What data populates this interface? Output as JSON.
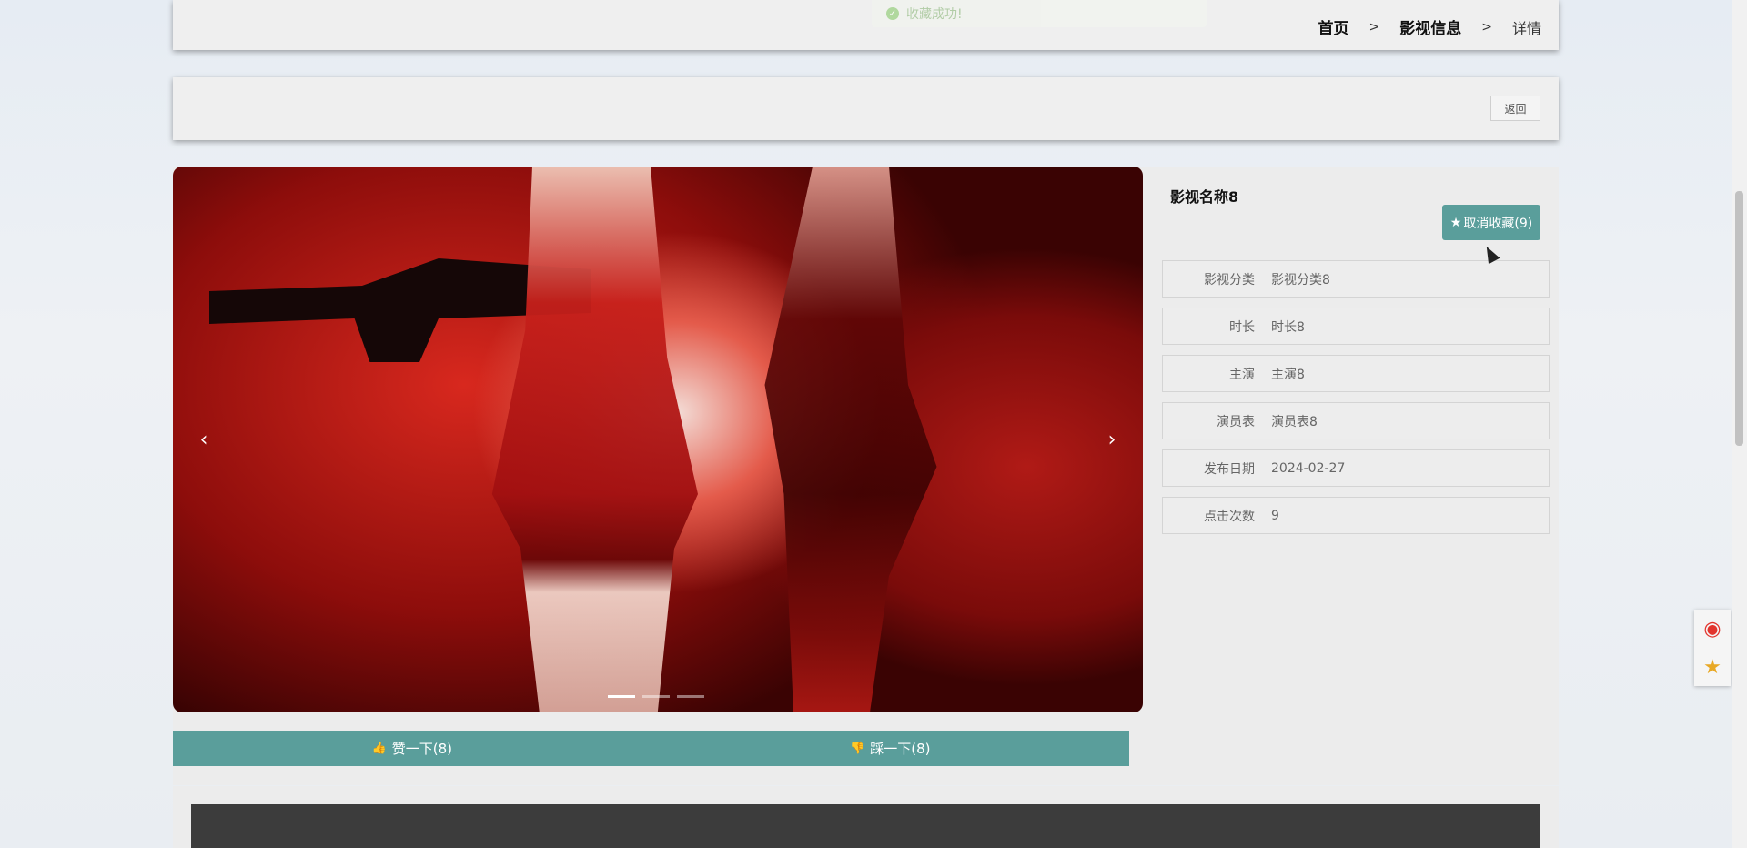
{
  "toast": {
    "message": "收藏成功!"
  },
  "breadcrumb": {
    "home": "首页",
    "section": "影视信息",
    "current": "详情",
    "separator": ">"
  },
  "back_button": "返回",
  "carousel": {
    "prev": "‹",
    "next": "›",
    "slide_count": 3,
    "active_slide": 1
  },
  "votes": {
    "like_label": "赞一下(8)",
    "dislike_label": "踩一下(8)"
  },
  "movie": {
    "title": "影视名称8",
    "favorite_button": "取消收藏(9)",
    "fields": [
      {
        "label": "影视分类",
        "value": "影视分类8"
      },
      {
        "label": "时长",
        "value": "时长8"
      },
      {
        "label": "主演",
        "value": "主演8"
      },
      {
        "label": "演员表",
        "value": "演员表8"
      },
      {
        "label": "发布日期",
        "value": "2024-02-27"
      },
      {
        "label": "点击次数",
        "value": "9"
      }
    ]
  },
  "colors": {
    "accent": "#5a9e9b",
    "panel": "#ececec"
  },
  "icons": {
    "like": "thumb-up-icon",
    "dislike": "thumb-down-icon",
    "favorite": "star-icon",
    "weibo": "weibo-icon",
    "qzone": "qzone-star-icon"
  }
}
